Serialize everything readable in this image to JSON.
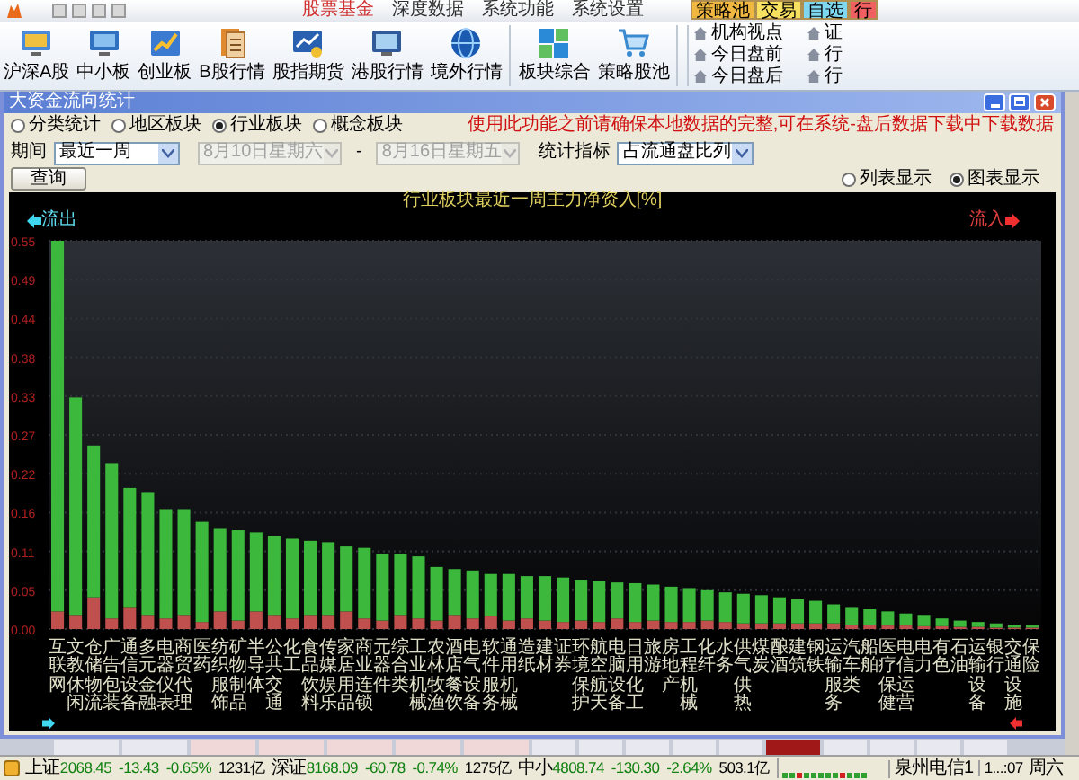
{
  "menu": [
    {
      "label": "股票基金",
      "selected": true
    },
    {
      "label": "深度数据",
      "selected": false
    },
    {
      "label": "系统功能",
      "selected": false
    },
    {
      "label": "系统设置",
      "selected": false
    }
  ],
  "quick_tabs": [
    {
      "label": "策略池",
      "color": "#f0b840"
    },
    {
      "label": "交易",
      "color": "#f8e060"
    },
    {
      "label": "自选",
      "color": "#80d8f0"
    },
    {
      "label": "行",
      "color": "#f06060"
    }
  ],
  "toolbar": {
    "buttons": [
      "沪深A股",
      "中小板",
      "创业板",
      "B股行情",
      "股指期货",
      "港股行情",
      "境外行情",
      "板块综合",
      "策略股池"
    ],
    "links": [
      "机构视点",
      "今日盘前",
      "今日盘后"
    ],
    "links_2": [
      "证",
      "行",
      "行"
    ]
  },
  "window": {
    "title": "大资金流向统计"
  },
  "form": {
    "scopes": [
      {
        "label": "分类统计",
        "selected": false
      },
      {
        "label": "地区板块",
        "selected": false
      },
      {
        "label": "行业板块",
        "selected": true
      },
      {
        "label": "概念板块",
        "selected": false
      }
    ],
    "notice": "使用此功能之前请确保本地数据的完整,可在系统-盘后数据下载中下载数据",
    "period_label": "期间",
    "period": "最近一周",
    "dates_disabled": true,
    "date_from": "8月10日星期六",
    "date_separator": "-",
    "date_to": "8月16日星期五",
    "metric_label": "统计指标",
    "metric": "占流通盘比列",
    "query_button": "查询",
    "views": [
      {
        "label": "列表显示",
        "selected": false
      },
      {
        "label": "图表显示",
        "selected": true
      }
    ]
  },
  "chart": {
    "outflow_label": "流出",
    "inflow_label": "流入",
    "chart_data": {
      "type": "bar",
      "title": "行业板块最近一周主力净资入[%]",
      "stacked": true,
      "categories": [
        "互联网",
        "文教休闲",
        "仓储物流",
        "广告包装",
        "通信设备",
        "多元金融",
        "电器仪表",
        "商贸代理",
        "医药",
        "纺织服饰",
        "矿物制品",
        "半导体",
        "公共交通",
        "化工",
        "食品饮料",
        "传媒娱乐",
        "家居用品",
        "商业连锁",
        "元器件",
        "综合类",
        "工业机械",
        "农林牧渔",
        "酒店餐饮",
        "电气设备",
        "软件服务",
        "通用机械",
        "造纸",
        "建材",
        "证券",
        "环境保护",
        "航空航天",
        "电脑设备",
        "日用化工",
        "旅游",
        "房地产",
        "工程机械",
        "化纤",
        "水务",
        "供气供热",
        "煤炭",
        "酿酒",
        "建筑",
        "钢铁",
        "运输服务",
        "汽车类",
        "船舶",
        "医疗保健",
        "电信运营",
        "电力",
        "有色",
        "石油",
        "运输设备",
        "银行",
        "交通设施",
        "保险"
      ],
      "series": [
        {
          "color": "#c0504d",
          "values": [
            0.025,
            0.02,
            0.045,
            0.015,
            0.03,
            0.02,
            0.015,
            0.02,
            0.01,
            0.025,
            0.012,
            0.025,
            0.02,
            0.015,
            0.02,
            0.02,
            0.025,
            0.015,
            0.012,
            0.02,
            0.015,
            0.012,
            0.02,
            0.015,
            0.018,
            0.012,
            0.015,
            0.012,
            0.01,
            0.012,
            0.01,
            0.015,
            0.01,
            0.012,
            0.01,
            0.01,
            0.012,
            0.01,
            0.008,
            0.008,
            0.008,
            0.008,
            0.008,
            0.008,
            0.006,
            0.006,
            0.005,
            0.005,
            0.004,
            0.004,
            0.003,
            0.003,
            0.002,
            0.002,
            0.002
          ]
        },
        {
          "color": "#3cb83c",
          "values": [
            0.525,
            0.308,
            0.215,
            0.22,
            0.17,
            0.173,
            0.155,
            0.15,
            0.142,
            0.117,
            0.128,
            0.112,
            0.112,
            0.113,
            0.105,
            0.103,
            0.092,
            0.1,
            0.095,
            0.087,
            0.088,
            0.076,
            0.065,
            0.068,
            0.06,
            0.066,
            0.06,
            0.063,
            0.063,
            0.058,
            0.058,
            0.051,
            0.055,
            0.051,
            0.05,
            0.048,
            0.043,
            0.042,
            0.042,
            0.04,
            0.037,
            0.034,
            0.032,
            0.027,
            0.024,
            0.022,
            0.02,
            0.017,
            0.016,
            0.011,
            0.009,
            0.007,
            0.006,
            0.004,
            0.003
          ]
        }
      ],
      "ylim": [
        0,
        0.55
      ],
      "grid": true,
      "yticks": [
        {
          "value": 0,
          "label": "0.00"
        },
        {
          "value": 0.055,
          "label": "0.05"
        },
        {
          "value": 0.11,
          "label": "0.11"
        },
        {
          "value": 0.165,
          "label": "0.16"
        },
        {
          "value": 0.22,
          "label": "0.22"
        },
        {
          "value": 0.275,
          "label": "0.27"
        },
        {
          "value": 0.33,
          "label": "0.33"
        },
        {
          "value": 0.385,
          "label": "0.38"
        },
        {
          "value": 0.44,
          "label": "0.44"
        },
        {
          "value": 0.495,
          "label": "0.49"
        },
        {
          "value": 0.55,
          "label": "0.55"
        }
      ]
    }
  },
  "status_bar": {
    "indices": [
      {
        "name": "上证",
        "value": "2068.45",
        "change": "-13.43",
        "percent": "-0.65%",
        "volume": "1231亿"
      },
      {
        "name": "深证",
        "value": "8168.09",
        "change": "-60.78",
        "percent": "-0.74%",
        "volume": "1275亿"
      },
      {
        "name": "中小",
        "value": "4808.74",
        "change": "-130.30",
        "percent": "-2.64%",
        "volume": "503.1亿"
      }
    ],
    "isp": "泉州电信1",
    "time": "1...:07",
    "weekday": "周六"
  }
}
